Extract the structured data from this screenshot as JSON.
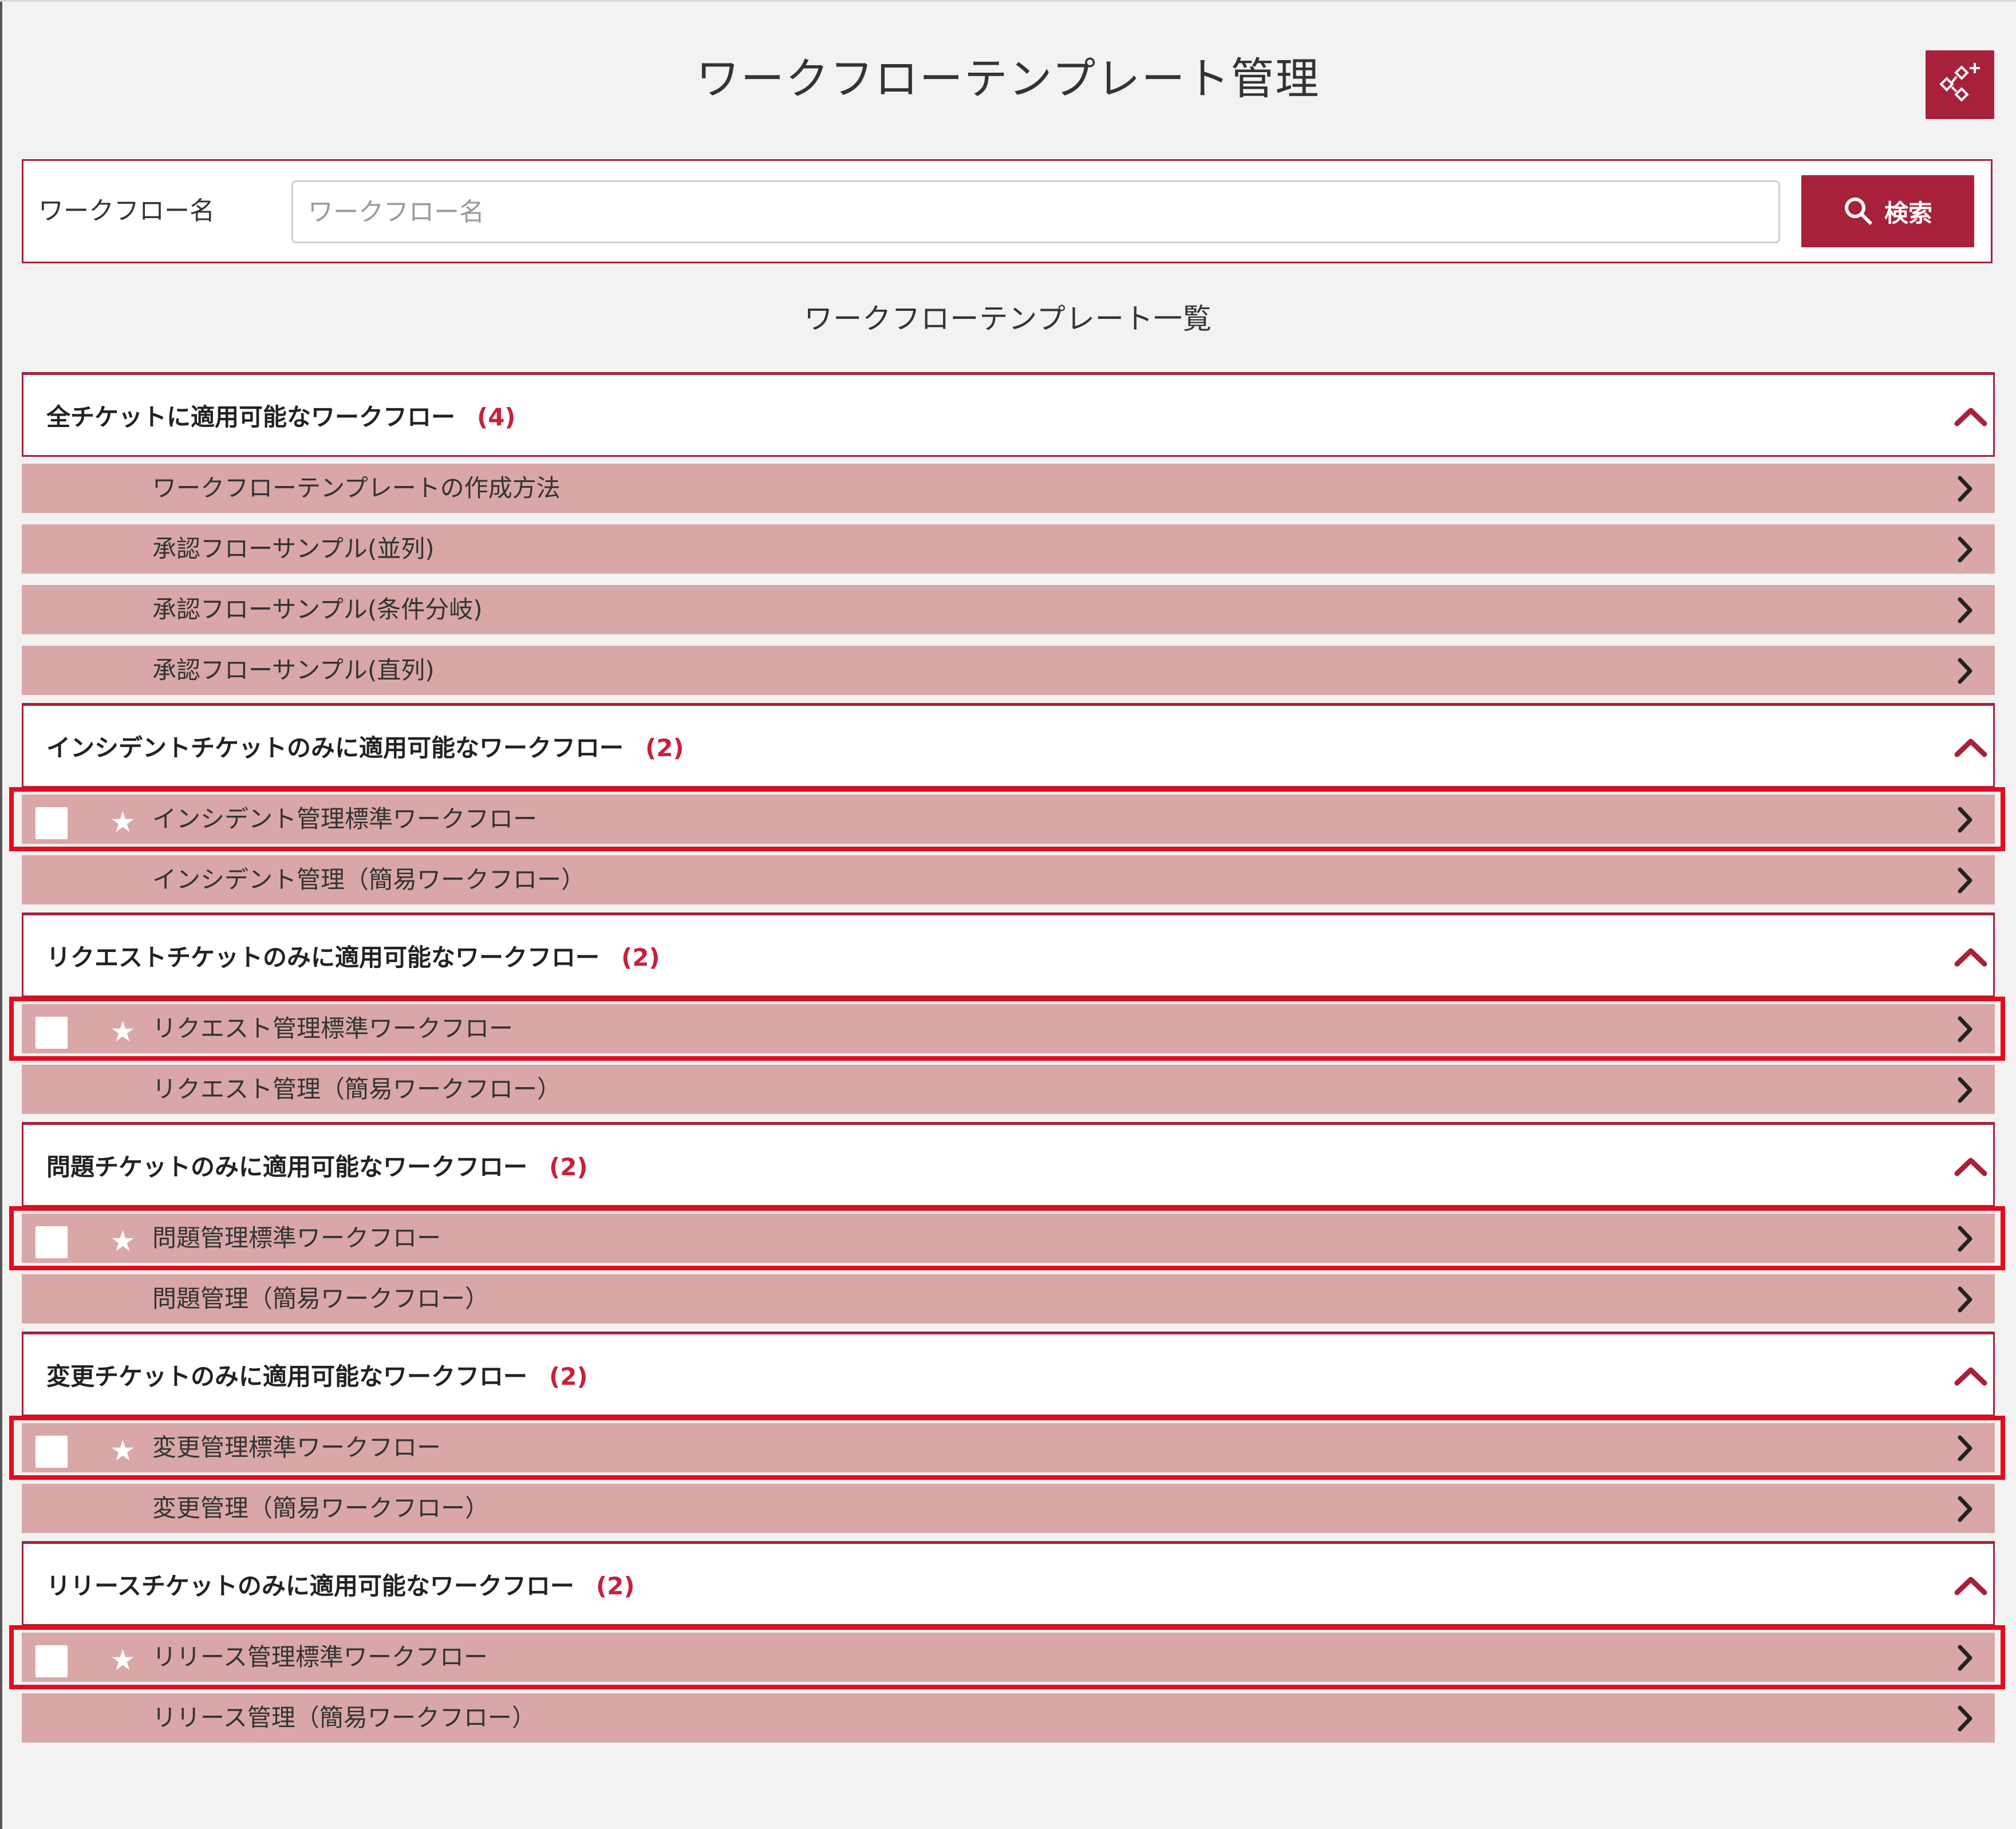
{
  "page": {
    "title": "ワークフローテンプレート管理",
    "add_button_icon": "workflow-add-icon",
    "list_title": "ワークフローテンプレート一覧"
  },
  "search": {
    "label": "ワークフロー名",
    "placeholder": "ワークフロー名",
    "value": "",
    "button_label": "検索",
    "button_icon": "search-icon"
  },
  "colors": {
    "accent": "#a8213a",
    "row_background": "#d9a7a7",
    "count": "#c8203b",
    "highlight": "#e60a1e"
  },
  "sections": [
    {
      "title": "全チケットに適用可能なワークフロー",
      "count": "(4)",
      "items": [
        {
          "label": "ワークフローテンプレートの作成方法",
          "checkbox": false,
          "starred": false,
          "highlighted": false
        },
        {
          "label": "承認フローサンプル(並列)",
          "checkbox": false,
          "starred": false,
          "highlighted": false
        },
        {
          "label": "承認フローサンプル(条件分岐)",
          "checkbox": false,
          "starred": false,
          "highlighted": false
        },
        {
          "label": "承認フローサンプル(直列)",
          "checkbox": false,
          "starred": false,
          "highlighted": false
        }
      ]
    },
    {
      "title": "インシデントチケットのみに適用可能なワークフロー",
      "count": "(2)",
      "items": [
        {
          "label": "インシデント管理標準ワークフロー",
          "checkbox": true,
          "starred": true,
          "highlighted": true
        },
        {
          "label": "インシデント管理（簡易ワークフロー）",
          "checkbox": false,
          "starred": false,
          "highlighted": false
        }
      ]
    },
    {
      "title": "リクエストチケットのみに適用可能なワークフロー",
      "count": "(2)",
      "items": [
        {
          "label": "リクエスト管理標準ワークフロー",
          "checkbox": true,
          "starred": true,
          "highlighted": true
        },
        {
          "label": "リクエスト管理（簡易ワークフロー）",
          "checkbox": false,
          "starred": false,
          "highlighted": false
        }
      ]
    },
    {
      "title": "問題チケットのみに適用可能なワークフロー",
      "count": "(2)",
      "items": [
        {
          "label": "問題管理標準ワークフロー",
          "checkbox": true,
          "starred": true,
          "highlighted": true
        },
        {
          "label": "問題管理（簡易ワークフロー）",
          "checkbox": false,
          "starred": false,
          "highlighted": false
        }
      ]
    },
    {
      "title": "変更チケットのみに適用可能なワークフロー",
      "count": "(2)",
      "items": [
        {
          "label": "変更管理標準ワークフロー",
          "checkbox": true,
          "starred": true,
          "highlighted": true
        },
        {
          "label": "変更管理（簡易ワークフロー）",
          "checkbox": false,
          "starred": false,
          "highlighted": false
        }
      ]
    },
    {
      "title": "リリースチケットのみに適用可能なワークフロー",
      "count": "(2)",
      "items": [
        {
          "label": "リリース管理標準ワークフロー",
          "checkbox": true,
          "starred": true,
          "highlighted": true
        },
        {
          "label": "リリース管理（簡易ワークフロー）",
          "checkbox": false,
          "starred": false,
          "highlighted": false
        }
      ]
    }
  ]
}
